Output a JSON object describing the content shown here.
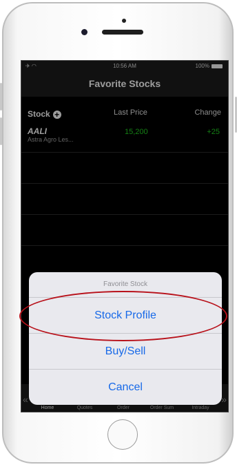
{
  "status": {
    "carrier_icons": "✈ ◠",
    "time": "10:56 AM",
    "battery": "100%"
  },
  "header": {
    "title": "Favorite Stocks"
  },
  "table": {
    "columns": [
      "Stock",
      "Last Price",
      "Change"
    ],
    "rows": [
      {
        "code": "AALI",
        "name": "Astra Agro Les...",
        "price": "15,200",
        "change": "+25"
      }
    ]
  },
  "tabs": [
    "Home",
    "Quotes",
    "Order",
    "Order Sum",
    "Intraday"
  ],
  "action_sheet": {
    "title": "Favorite Stock",
    "options": [
      "Stock Profile",
      "Buy/Sell",
      "Cancel"
    ]
  },
  "colors": {
    "up": "#21c321",
    "action": "#1769e8",
    "annotation": "#b8111a"
  }
}
